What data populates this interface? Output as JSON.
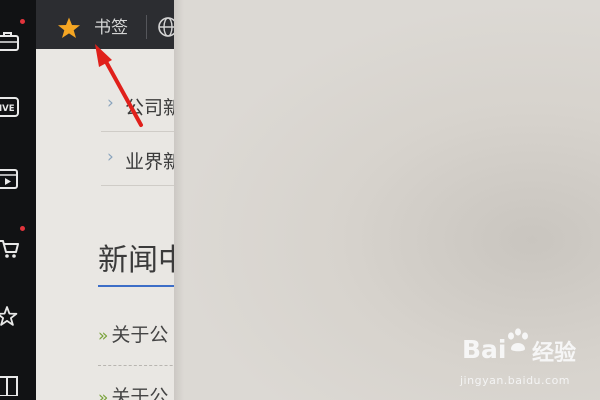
{
  "sidebar": {
    "icons": [
      {
        "name": "briefcase-icon",
        "has_badge": true
      },
      {
        "name": "live-icon",
        "label": "IVE"
      },
      {
        "name": "video-icon"
      },
      {
        "name": "cart-icon",
        "has_badge": true
      },
      {
        "name": "star-outline-icon"
      },
      {
        "name": "book-icon"
      }
    ],
    "badge_color": "#e2343c"
  },
  "toolbar": {
    "bookmark_label": "书签",
    "star_color": "#f5a623"
  },
  "menu": {
    "items": [
      {
        "label": "公司新"
      },
      {
        "label": "业界新"
      }
    ]
  },
  "section": {
    "title": "新闻中"
  },
  "news": {
    "items": [
      {
        "bullet": "»",
        "label": "关于公"
      },
      {
        "bullet": "»",
        "label": "关于公"
      }
    ]
  },
  "annotation": {
    "arrow_color": "#e0201b"
  },
  "watermark": {
    "brand": "Bai",
    "brand_suffix": "经验",
    "url": "jingyan.baidu.com"
  }
}
